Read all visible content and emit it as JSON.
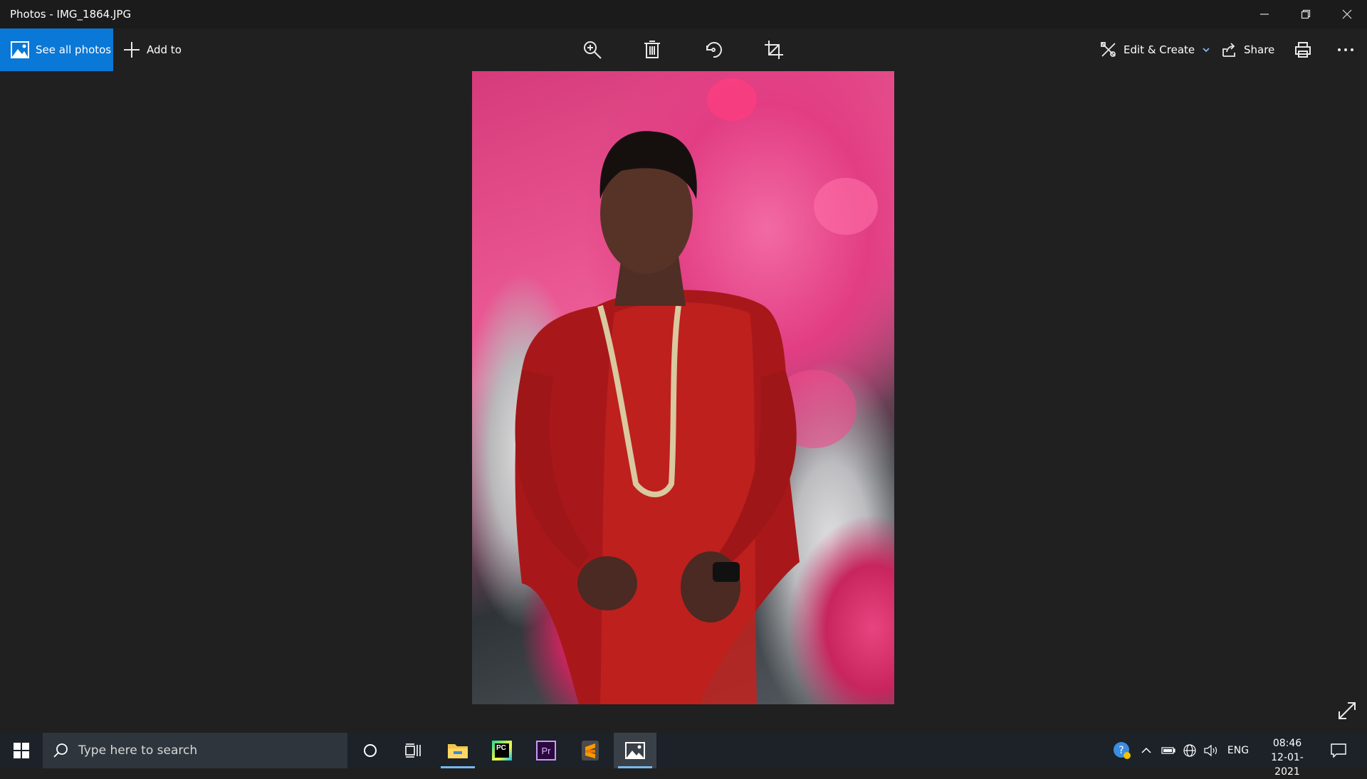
{
  "window": {
    "title": "Photos - IMG_1864.JPG",
    "minimize_icon": "minimize-icon",
    "restore_icon": "restore-icon",
    "close_icon": "close-icon"
  },
  "toolbar": {
    "see_all_photos": "See all photos",
    "add_to": "Add to",
    "zoom_icon": "zoom-in-icon",
    "delete_icon": "trash-icon",
    "rotate_icon": "rotate-icon",
    "crop_icon": "crop-icon",
    "edit_create": "Edit & Create",
    "share": "Share",
    "print_icon": "print-icon",
    "more_icon": "more-icon"
  },
  "taskbar": {
    "search_placeholder": "Type here to search",
    "language": "ENG",
    "time": "08:46",
    "date": "12-01-2021",
    "apps": [
      "cortana",
      "task-view",
      "file-explorer",
      "pycharm",
      "premiere-pro",
      "sublime-text",
      "photos"
    ],
    "pycharm_label": "PC",
    "premiere_label": "Pr"
  },
  "colors": {
    "accent": "#0a78d7",
    "background": "#202020",
    "taskbar": "#1c2228"
  }
}
